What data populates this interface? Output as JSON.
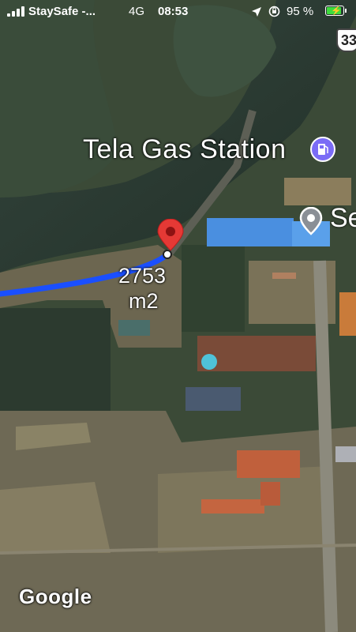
{
  "status_bar": {
    "carrier": "StaySafe -...",
    "network": "4G",
    "time": "08:53",
    "battery_percent": "95 %",
    "battery_level": 0.95,
    "icons": [
      "signal-icon",
      "location-arrow-icon",
      "orientation-lock-icon",
      "battery-charging-icon"
    ]
  },
  "map": {
    "poi_gas_station": "Tela Gas Station",
    "poi_partial_label": "Se",
    "road_shield": "33",
    "measurement_value": "2753",
    "measurement_unit": "m2",
    "attribution": "Google",
    "route_color": "#1a4fff",
    "pin_color": "#e53935",
    "gas_icon_color": "#7b6cf6",
    "icons": [
      "gas-station-icon",
      "place-pin-icon",
      "dropped-pin-icon"
    ]
  }
}
